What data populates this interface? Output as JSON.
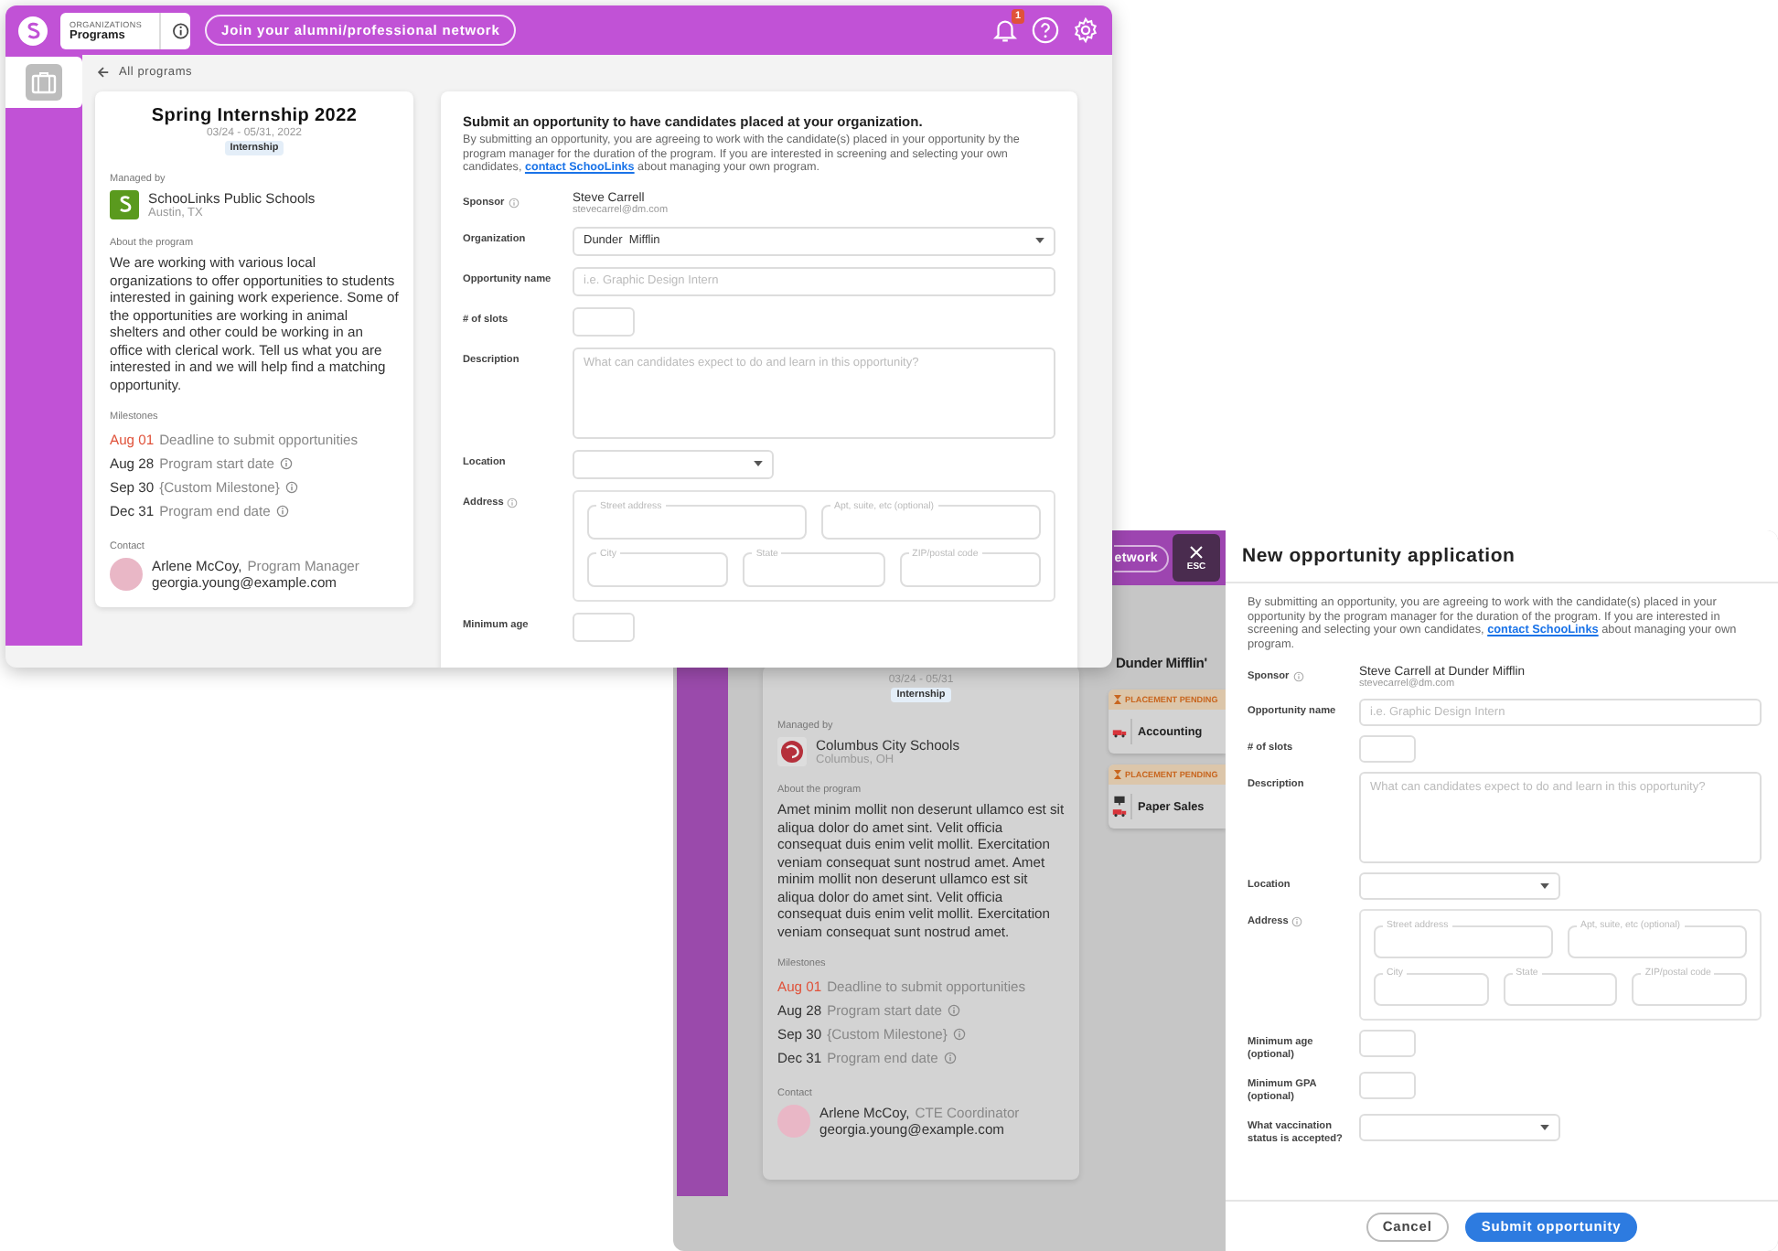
{
  "program_window": {
    "header": {
      "org_label": "ORGANIZATIONS",
      "org_name": "Programs",
      "network_button": "Join your alumni/professional network",
      "notification_count": "1"
    },
    "back_link": "All programs",
    "program": {
      "title": "Spring Internship 2022",
      "dates": "03/24 - 05/31, 2022",
      "tag": "Internship",
      "managed_by_label": "Managed by",
      "org_name": "SchooLinks Public Schools",
      "org_location": "Austin, TX",
      "about_label": "About the program",
      "about": "We are working with various local organizations to offer opportunities to students interested in gaining work experience. Some of the opportunities are working in animal shelters and other could be working in an office with clerical work. Tell us what you are interested in and we will help find a matching opportunity.",
      "milestones_label": "Milestones",
      "milestones": [
        {
          "date": "Aug 01",
          "label": "Deadline to submit opportunities",
          "overdue": true,
          "info": false
        },
        {
          "date": "Aug 28",
          "label": "Program start date",
          "overdue": false,
          "info": true
        },
        {
          "date": "Sep 30",
          "label": "{Custom Milestone}",
          "overdue": false,
          "info": true
        },
        {
          "date": "Dec 31",
          "label": "Program end date",
          "overdue": false,
          "info": true
        }
      ],
      "contact_label": "Contact",
      "contact_name": "Arlene McCoy,",
      "contact_role": "Program Manager",
      "contact_email": "georgia.young@example.com"
    },
    "form": {
      "title": "Submit an opportunity to have candidates placed at your organization.",
      "intro": "By submitting an opportunity, you are agreeing to work with the candidate(s) placed in your opportunity by the program manager for the duration of the program. If you are interested in screening and selecting your own candidates, ",
      "link": "contact SchooLinks",
      "intro_end": " about managing your own program.",
      "fields": [
        {
          "kind": "sponsor",
          "label": "Sponsor",
          "info": true,
          "name": "Steve Carrell",
          "email": "stevecarrel@dm.com"
        },
        {
          "kind": "dropdown",
          "label": "Organization",
          "info": false,
          "value": "Dunder  Mifflin"
        },
        {
          "kind": "text",
          "label": "Opportunity name",
          "info": false,
          "placeholder": "i.e. Graphic Design Intern"
        },
        {
          "kind": "number",
          "label": "# of slots",
          "info": false
        },
        {
          "kind": "textarea",
          "label": "Description",
          "info": false,
          "placeholder": "What can candidates expect to do and learn in this opportunity?"
        },
        {
          "kind": "short-dropdown",
          "label": "Location",
          "info": false
        },
        {
          "kind": "address",
          "label": "Address",
          "info": true,
          "parts": [
            "Street address",
            "Apt, suite, etc (optional)",
            "City",
            "State",
            "ZIP/postal code"
          ]
        },
        {
          "kind": "number",
          "label": "Minimum age",
          "info": false
        }
      ]
    }
  },
  "application_window": {
    "header": {
      "network_button": "etwork",
      "close_hint": "ESC"
    },
    "program": {
      "dates": "03/24 - 05/31",
      "tag": "Internship",
      "managed_by_label": "Managed by",
      "org_name": "Columbus City Schools",
      "org_location": "Columbus, OH",
      "about_label": "About the program",
      "about": "Amet minim mollit non deserunt ullamco est sit aliqua dolor do amet sint. Velit officia consequat duis enim velit mollit. Exercitation veniam consequat sunt nostrud amet. Amet minim mollit non deserunt ullamco est sit aliqua dolor do amet sint. Velit officia consequat duis enim velit mollit. Exercitation veniam consequat sunt nostrud amet.",
      "milestones_label": "Milestones",
      "milestones": [
        {
          "date": "Aug 01",
          "label": "Deadline to submit opportunities",
          "overdue": true,
          "info": false
        },
        {
          "date": "Aug 28",
          "label": "Program start date",
          "overdue": false,
          "info": true
        },
        {
          "date": "Sep 30",
          "label": "{Custom Milestone}",
          "overdue": false,
          "info": true
        },
        {
          "date": "Dec 31",
          "label": "Program end date",
          "overdue": false,
          "info": true
        }
      ],
      "contact_label": "Contact",
      "contact_name": "Arlene McCoy,",
      "contact_role": "CTE Coordinator",
      "contact_email": "georgia.young@example.com"
    },
    "org_heading": "Dunder Mifflin'",
    "opportunities": [
      {
        "status": "PLACEMENT PENDING",
        "name": "Accounting"
      },
      {
        "status": "PLACEMENT PENDING",
        "name": "Paper Sales"
      }
    ],
    "modal": {
      "title": "New opportunity application",
      "intro": "By submitting an opportunity, you are agreeing to work with the candidate(s) placed in your opportunity by the program manager for the duration of the program. If you are interested in screening and selecting your own candidates, ",
      "link": "contact SchooLinks",
      "intro_end": " about managing your own program.",
      "fields": [
        {
          "kind": "sponsor",
          "label": "Sponsor",
          "info": true,
          "name": "Steve Carrell at Dunder Mifflin",
          "email": "stevecarrel@dm.com"
        },
        {
          "kind": "text",
          "label": "Opportunity name",
          "info": false,
          "placeholder": "i.e. Graphic Design Intern"
        },
        {
          "kind": "number",
          "label": "# of slots",
          "info": false
        },
        {
          "kind": "textarea",
          "label": "Description",
          "info": false,
          "placeholder": "What can candidates expect to do and learn in this opportunity?"
        },
        {
          "kind": "short-dropdown",
          "label": "Location",
          "info": false
        },
        {
          "kind": "address",
          "label": "Address",
          "info": true,
          "parts": [
            "Street address",
            "Apt, suite, etc (optional)",
            "City",
            "State",
            "ZIP/postal code"
          ]
        },
        {
          "kind": "number",
          "label": "Minimum age (optional)",
          "info": false
        },
        {
          "kind": "number",
          "label": "Minimum GPA (optional)",
          "info": false
        },
        {
          "kind": "short-dropdown",
          "label": "What vaccination status is accepted?",
          "info": false
        }
      ],
      "buttons": [
        {
          "label": "Cancel",
          "kind": "secondary"
        },
        {
          "label": "Submit opportunity",
          "kind": "primary"
        }
      ]
    }
  }
}
